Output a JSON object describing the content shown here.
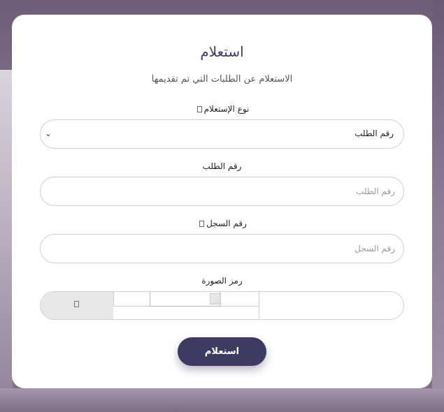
{
  "form": {
    "title": "استعلام",
    "subtitle": "الاستعلام عن الطلبات التي تم تقديمها",
    "inquiry_type_label": "نوع الإستعلام",
    "inquiry_type_value": "رقم الطلب",
    "request_number_label": "رقم الطلب",
    "request_number_placeholder": "رقم الطلب",
    "registry_number_label": "رقم السجل",
    "registry_number_placeholder": "رقم السجل",
    "captcha_label": "رمز الصورة",
    "submit_label": "استعلام"
  },
  "colors": {
    "accent": "#3e3b63"
  }
}
